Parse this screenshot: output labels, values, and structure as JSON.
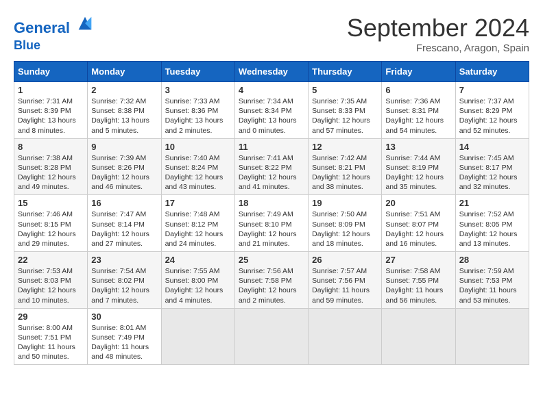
{
  "header": {
    "logo_line1": "General",
    "logo_line2": "Blue",
    "month": "September 2024",
    "location": "Frescano, Aragon, Spain"
  },
  "weekdays": [
    "Sunday",
    "Monday",
    "Tuesday",
    "Wednesday",
    "Thursday",
    "Friday",
    "Saturday"
  ],
  "weeks": [
    [
      {
        "day": "1",
        "sunrise": "Sunrise: 7:31 AM",
        "sunset": "Sunset: 8:39 PM",
        "daylight": "Daylight: 13 hours and 8 minutes."
      },
      {
        "day": "2",
        "sunrise": "Sunrise: 7:32 AM",
        "sunset": "Sunset: 8:38 PM",
        "daylight": "Daylight: 13 hours and 5 minutes."
      },
      {
        "day": "3",
        "sunrise": "Sunrise: 7:33 AM",
        "sunset": "Sunset: 8:36 PM",
        "daylight": "Daylight: 13 hours and 2 minutes."
      },
      {
        "day": "4",
        "sunrise": "Sunrise: 7:34 AM",
        "sunset": "Sunset: 8:34 PM",
        "daylight": "Daylight: 13 hours and 0 minutes."
      },
      {
        "day": "5",
        "sunrise": "Sunrise: 7:35 AM",
        "sunset": "Sunset: 8:33 PM",
        "daylight": "Daylight: 12 hours and 57 minutes."
      },
      {
        "day": "6",
        "sunrise": "Sunrise: 7:36 AM",
        "sunset": "Sunset: 8:31 PM",
        "daylight": "Daylight: 12 hours and 54 minutes."
      },
      {
        "day": "7",
        "sunrise": "Sunrise: 7:37 AM",
        "sunset": "Sunset: 8:29 PM",
        "daylight": "Daylight: 12 hours and 52 minutes."
      }
    ],
    [
      {
        "day": "8",
        "sunrise": "Sunrise: 7:38 AM",
        "sunset": "Sunset: 8:28 PM",
        "daylight": "Daylight: 12 hours and 49 minutes."
      },
      {
        "day": "9",
        "sunrise": "Sunrise: 7:39 AM",
        "sunset": "Sunset: 8:26 PM",
        "daylight": "Daylight: 12 hours and 46 minutes."
      },
      {
        "day": "10",
        "sunrise": "Sunrise: 7:40 AM",
        "sunset": "Sunset: 8:24 PM",
        "daylight": "Daylight: 12 hours and 43 minutes."
      },
      {
        "day": "11",
        "sunrise": "Sunrise: 7:41 AM",
        "sunset": "Sunset: 8:22 PM",
        "daylight": "Daylight: 12 hours and 41 minutes."
      },
      {
        "day": "12",
        "sunrise": "Sunrise: 7:42 AM",
        "sunset": "Sunset: 8:21 PM",
        "daylight": "Daylight: 12 hours and 38 minutes."
      },
      {
        "day": "13",
        "sunrise": "Sunrise: 7:44 AM",
        "sunset": "Sunset: 8:19 PM",
        "daylight": "Daylight: 12 hours and 35 minutes."
      },
      {
        "day": "14",
        "sunrise": "Sunrise: 7:45 AM",
        "sunset": "Sunset: 8:17 PM",
        "daylight": "Daylight: 12 hours and 32 minutes."
      }
    ],
    [
      {
        "day": "15",
        "sunrise": "Sunrise: 7:46 AM",
        "sunset": "Sunset: 8:15 PM",
        "daylight": "Daylight: 12 hours and 29 minutes."
      },
      {
        "day": "16",
        "sunrise": "Sunrise: 7:47 AM",
        "sunset": "Sunset: 8:14 PM",
        "daylight": "Daylight: 12 hours and 27 minutes."
      },
      {
        "day": "17",
        "sunrise": "Sunrise: 7:48 AM",
        "sunset": "Sunset: 8:12 PM",
        "daylight": "Daylight: 12 hours and 24 minutes."
      },
      {
        "day": "18",
        "sunrise": "Sunrise: 7:49 AM",
        "sunset": "Sunset: 8:10 PM",
        "daylight": "Daylight: 12 hours and 21 minutes."
      },
      {
        "day": "19",
        "sunrise": "Sunrise: 7:50 AM",
        "sunset": "Sunset: 8:09 PM",
        "daylight": "Daylight: 12 hours and 18 minutes."
      },
      {
        "day": "20",
        "sunrise": "Sunrise: 7:51 AM",
        "sunset": "Sunset: 8:07 PM",
        "daylight": "Daylight: 12 hours and 16 minutes."
      },
      {
        "day": "21",
        "sunrise": "Sunrise: 7:52 AM",
        "sunset": "Sunset: 8:05 PM",
        "daylight": "Daylight: 12 hours and 13 minutes."
      }
    ],
    [
      {
        "day": "22",
        "sunrise": "Sunrise: 7:53 AM",
        "sunset": "Sunset: 8:03 PM",
        "daylight": "Daylight: 12 hours and 10 minutes."
      },
      {
        "day": "23",
        "sunrise": "Sunrise: 7:54 AM",
        "sunset": "Sunset: 8:02 PM",
        "daylight": "Daylight: 12 hours and 7 minutes."
      },
      {
        "day": "24",
        "sunrise": "Sunrise: 7:55 AM",
        "sunset": "Sunset: 8:00 PM",
        "daylight": "Daylight: 12 hours and 4 minutes."
      },
      {
        "day": "25",
        "sunrise": "Sunrise: 7:56 AM",
        "sunset": "Sunset: 7:58 PM",
        "daylight": "Daylight: 12 hours and 2 minutes."
      },
      {
        "day": "26",
        "sunrise": "Sunrise: 7:57 AM",
        "sunset": "Sunset: 7:56 PM",
        "daylight": "Daylight: 11 hours and 59 minutes."
      },
      {
        "day": "27",
        "sunrise": "Sunrise: 7:58 AM",
        "sunset": "Sunset: 7:55 PM",
        "daylight": "Daylight: 11 hours and 56 minutes."
      },
      {
        "day": "28",
        "sunrise": "Sunrise: 7:59 AM",
        "sunset": "Sunset: 7:53 PM",
        "daylight": "Daylight: 11 hours and 53 minutes."
      }
    ],
    [
      {
        "day": "29",
        "sunrise": "Sunrise: 8:00 AM",
        "sunset": "Sunset: 7:51 PM",
        "daylight": "Daylight: 11 hours and 50 minutes."
      },
      {
        "day": "30",
        "sunrise": "Sunrise: 8:01 AM",
        "sunset": "Sunset: 7:49 PM",
        "daylight": "Daylight: 11 hours and 48 minutes."
      },
      null,
      null,
      null,
      null,
      null
    ]
  ]
}
